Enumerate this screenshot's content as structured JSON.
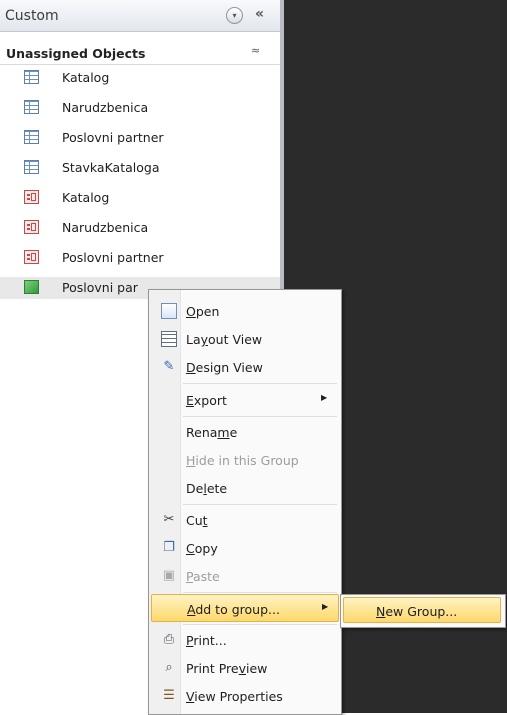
{
  "nav_pane": {
    "title": "Custom",
    "dropdown_glyph": "▾",
    "collapse_glyph": "«",
    "group": {
      "title": "Unassigned Objects",
      "toggle_glyph": "≈"
    },
    "objects": [
      {
        "label": "Katalog",
        "icon": "table-icon"
      },
      {
        "label": "Narudzbenica",
        "icon": "table-icon"
      },
      {
        "label": "Poslovni partner",
        "icon": "table-icon"
      },
      {
        "label": "StavkaKataloga",
        "icon": "table-icon"
      },
      {
        "label": "Katalog",
        "icon": "form-icon"
      },
      {
        "label": "Narudzbenica",
        "icon": "form-icon"
      },
      {
        "label": "Poslovni partner",
        "icon": "form-icon"
      },
      {
        "label": "Poslovni par",
        "icon": "report-icon"
      }
    ]
  },
  "context_menu": {
    "items": {
      "open": {
        "pre": "",
        "key": "O",
        "post": "pen"
      },
      "layout_view": {
        "pre": "La",
        "key": "y",
        "post": "out View"
      },
      "design_view": {
        "pre": "",
        "key": "D",
        "post": "esign View"
      },
      "export": {
        "pre": "",
        "key": "E",
        "post": "xport"
      },
      "rename": {
        "pre": "Rena",
        "key": "m",
        "post": "e"
      },
      "hide": {
        "pre": "",
        "key": "H",
        "post": "ide in this Group"
      },
      "delete": {
        "pre": "De",
        "key": "l",
        "post": "ete"
      },
      "cut": {
        "pre": "Cu",
        "key": "t",
        "post": ""
      },
      "copy": {
        "pre": "",
        "key": "C",
        "post": "opy"
      },
      "paste": {
        "pre": "",
        "key": "P",
        "post": "aste"
      },
      "add_to_group": {
        "pre": "",
        "key": "A",
        "post": "dd to group..."
      },
      "print": {
        "pre": "",
        "key": "P",
        "post": "rint..."
      },
      "print_preview": {
        "pre": "Print Pre",
        "key": "v",
        "post": "iew"
      },
      "view_properties": {
        "pre": "",
        "key": "V",
        "post": "iew Properties"
      }
    },
    "submenu_arrow": "▶"
  },
  "submenu": {
    "new_group": {
      "pre": "",
      "key": "N",
      "post": "ew Group..."
    }
  },
  "colors": {
    "workspace": "#2b2b2b",
    "highlight": "#fdd86b",
    "selected_row": "#e8e8e8"
  }
}
